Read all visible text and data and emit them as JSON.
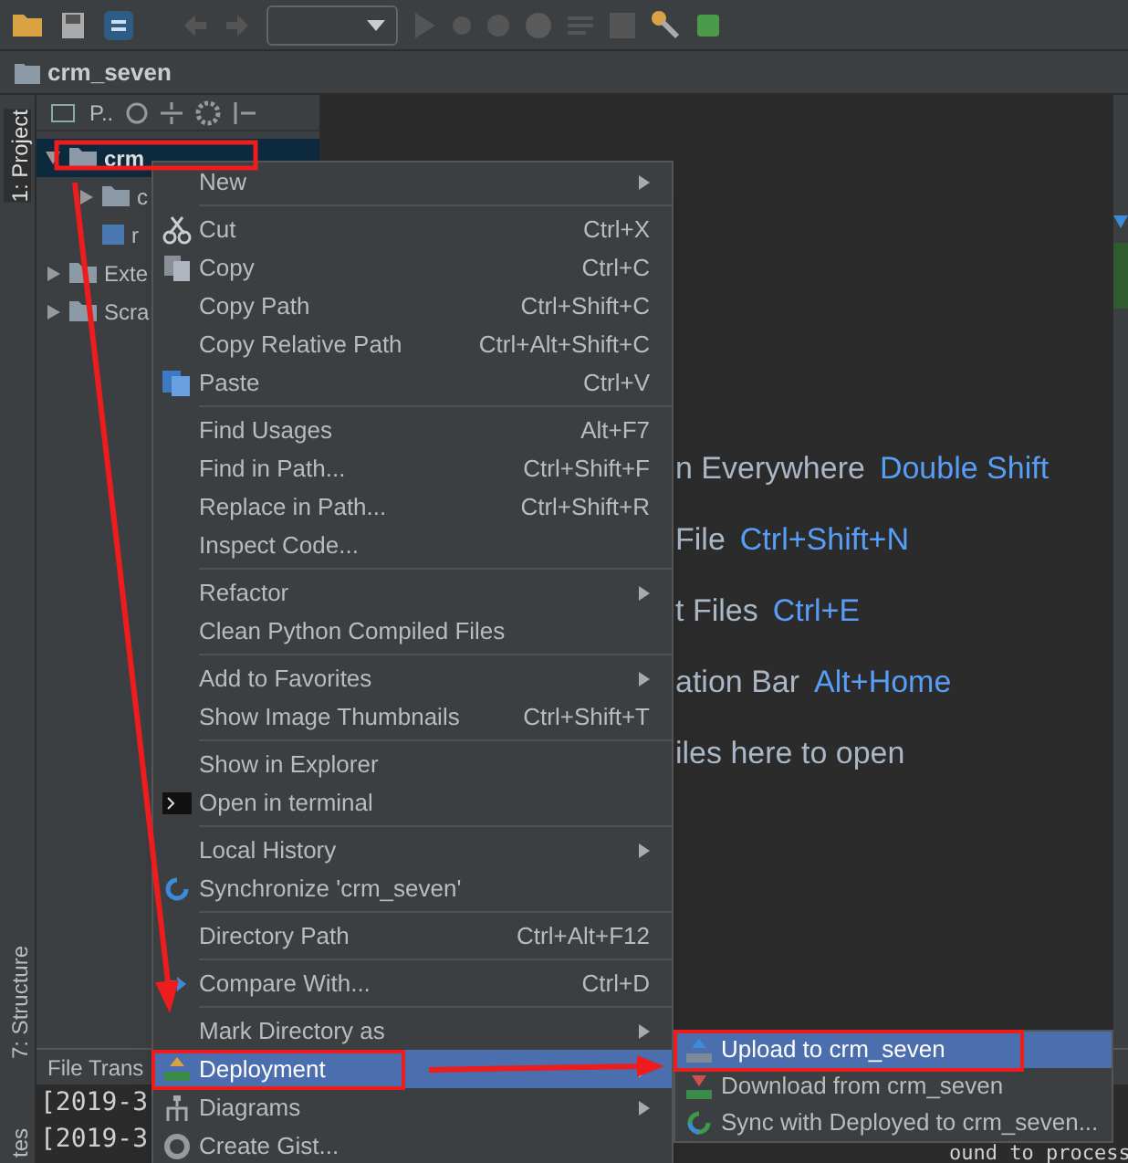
{
  "nav_bar": {
    "path": "crm_seven"
  },
  "side_tabs": [
    {
      "label": "1: Project",
      "selected": true
    },
    {
      "label": "7: Structure",
      "selected": false
    },
    {
      "label": "tes",
      "selected": false
    }
  ],
  "project_panel": {
    "view_label": "P..",
    "tree": [
      {
        "label": "crm",
        "selected": true,
        "expanded": true,
        "children": [
          {
            "label": "c",
            "selected": false,
            "expanded": false
          },
          {
            "label": "r",
            "selected": false
          }
        ]
      },
      {
        "label": "Exte",
        "selected": false,
        "expanded": false
      },
      {
        "label": "Scra",
        "selected": false,
        "expanded": false
      }
    ]
  },
  "editor_hints": [
    {
      "text": "n Everywhere",
      "shortcut": "Double Shift"
    },
    {
      "text": "File",
      "shortcut": "Ctrl+Shift+N"
    },
    {
      "text": "t Files",
      "shortcut": "Ctrl+E"
    },
    {
      "text": "ation Bar",
      "shortcut": "Alt+Home"
    },
    {
      "text": "iles here to open"
    }
  ],
  "bottom_panel": {
    "title": "File Trans",
    "lines": [
      "[2019-3",
      "[2019-3"
    ],
    "trailing_text": "ound to process"
  },
  "context_menu": {
    "groups": [
      [
        {
          "label": "New",
          "submenu": true,
          "selected": false
        }
      ],
      [
        {
          "label": "Cut",
          "shortcut": "Ctrl+X",
          "selected": false
        },
        {
          "label": "Copy",
          "shortcut": "Ctrl+C",
          "selected": false
        },
        {
          "label": "Copy Path",
          "shortcut": "Ctrl+Shift+C",
          "selected": false
        },
        {
          "label": "Copy Relative Path",
          "shortcut": "Ctrl+Alt+Shift+C",
          "selected": false
        },
        {
          "label": "Paste",
          "shortcut": "Ctrl+V",
          "selected": false
        }
      ],
      [
        {
          "label": "Find Usages",
          "shortcut": "Alt+F7",
          "selected": false
        },
        {
          "label": "Find in Path...",
          "shortcut": "Ctrl+Shift+F",
          "selected": false
        },
        {
          "label": "Replace in Path...",
          "shortcut": "Ctrl+Shift+R",
          "selected": false
        },
        {
          "label": "Inspect Code...",
          "selected": false
        }
      ],
      [
        {
          "label": "Refactor",
          "submenu": true,
          "selected": false
        },
        {
          "label": "Clean Python Compiled Files",
          "selected": false
        }
      ],
      [
        {
          "label": "Add to Favorites",
          "submenu": true,
          "selected": false
        },
        {
          "label": "Show Image Thumbnails",
          "shortcut": "Ctrl+Shift+T",
          "selected": false
        }
      ],
      [
        {
          "label": "Show in Explorer",
          "selected": false
        },
        {
          "label": "Open in terminal",
          "selected": false
        }
      ],
      [
        {
          "label": "Local History",
          "submenu": true,
          "selected": false
        },
        {
          "label": "Synchronize 'crm_seven'",
          "selected": false
        }
      ],
      [
        {
          "label": "Directory Path",
          "shortcut": "Ctrl+Alt+F12",
          "selected": false
        }
      ],
      [
        {
          "label": "Compare With...",
          "shortcut": "Ctrl+D",
          "selected": false
        }
      ],
      [
        {
          "label": "Mark Directory as",
          "submenu": true,
          "selected": false
        },
        {
          "label": "Deployment",
          "submenu": true,
          "selected": true
        },
        {
          "label": "Diagrams",
          "submenu": true,
          "selected": false
        },
        {
          "label": "Create Gist...",
          "selected": false
        }
      ]
    ]
  },
  "submenu": {
    "items": [
      {
        "label": "Upload to crm_seven",
        "selected": true
      },
      {
        "label": "Download from crm_seven",
        "selected": false
      },
      {
        "label": "Sync with Deployed to crm_seven...",
        "selected": false
      }
    ]
  }
}
